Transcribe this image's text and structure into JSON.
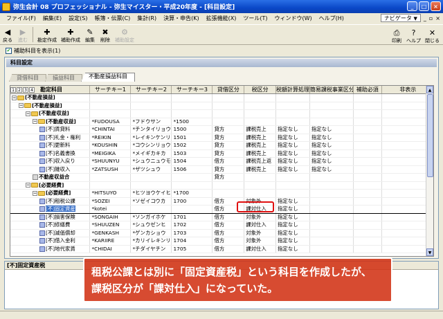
{
  "window": {
    "title": "弥生会計 08 プロフェッショナル - 弥生マイスター・平成20年度 - [科目設定]"
  },
  "menu": [
    "ファイル(F)",
    "編集(E)",
    "設定(S)",
    "帳簿・伝票(C)",
    "集計(R)",
    "決算・申告(K)",
    "拡張機能(X)",
    "ツール(T)",
    "ウィンドウ(W)",
    "ヘルプ(H)"
  ],
  "navi": {
    "label": "ナビゲータ"
  },
  "toolbar": {
    "left": [
      {
        "label": "戻る",
        "icon": "back-icon"
      },
      {
        "label": "進む",
        "icon": "forward-icon",
        "disabled": true
      },
      {
        "label": "勘定作成",
        "icon": "account-create-icon"
      },
      {
        "label": "補助作成",
        "icon": "sub-create-icon"
      },
      {
        "label": "編集",
        "icon": "edit-icon"
      },
      {
        "label": "削除",
        "icon": "delete-icon"
      },
      {
        "label": "補助設定",
        "icon": "sub-setting-icon",
        "disabled": true
      }
    ],
    "right": [
      {
        "label": "印刷",
        "icon": "print-icon"
      },
      {
        "label": "ヘルプ",
        "icon": "help-icon"
      },
      {
        "label": "閉じる",
        "icon": "close-icon"
      }
    ]
  },
  "show_sub_accounts": {
    "label": "補助科目を表示(1)",
    "checked": true
  },
  "panel": {
    "title": "科目設定"
  },
  "tabs": [
    "貸借科目",
    "損益科目",
    "不動産損益科目"
  ],
  "grid": {
    "columns": [
      "勘定科目",
      "サーチキー1",
      "サーチキー2",
      "サーチキー3",
      "貸借区分",
      "税区分",
      "税額計算処理",
      "簡易課税事業区分",
      "補助必須",
      "非表示"
    ],
    "rows": [
      {
        "indent": 0,
        "type": "folder",
        "name": "[不動産損益]",
        "bold": true,
        "k1": "",
        "k2": "",
        "k3": "",
        "tk": "",
        "tax": "",
        "calc": "",
        "simple": ""
      },
      {
        "indent": 1,
        "type": "folder",
        "name": "[不動産損益]",
        "bold": true,
        "k1": "",
        "k2": "",
        "k3": "",
        "tk": "",
        "tax": "",
        "calc": "",
        "simple": ""
      },
      {
        "indent": 2,
        "type": "folder",
        "name": "[不動産収益]",
        "bold": true,
        "k1": "",
        "k2": "",
        "k3": "",
        "tk": "",
        "tax": "",
        "calc": "",
        "simple": ""
      },
      {
        "indent": 3,
        "type": "folder",
        "name": "[不動産収益]",
        "bold": true,
        "k1": "*FUDOUSA",
        "k2": "*フドウサン",
        "k3": "*1500",
        "tk": "",
        "tax": "",
        "calc": "",
        "simple": ""
      },
      {
        "indent": 4,
        "type": "doc",
        "name": "[不]賃貸料",
        "k1": "*CHINTAI",
        "k2": "*チンタイリョウ",
        "k3": "1500",
        "tk": "貸方",
        "tax": "課税売上",
        "calc": "指定なし",
        "simple": "指定なし"
      },
      {
        "indent": 4,
        "type": "doc",
        "name": "[不]礼金・権利",
        "k1": "*REIKIN",
        "k2": "*レイキンケンリ",
        "k3": "1501",
        "tk": "貸方",
        "tax": "課税売上",
        "calc": "指定なし",
        "simple": "指定なし"
      },
      {
        "indent": 4,
        "type": "doc",
        "name": "[不]更新料",
        "k1": "*KOUSHIN",
        "k2": "*コウシンリョウ",
        "k3": "1502",
        "tk": "貸方",
        "tax": "課税売上",
        "calc": "指定なし",
        "simple": "指定なし"
      },
      {
        "indent": 4,
        "type": "doc",
        "name": "[不]名義書換",
        "k1": "*MEIGIKA",
        "k2": "*メイギカキカ",
        "k3": "1503",
        "tk": "貸方",
        "tax": "課税売上",
        "calc": "指定なし",
        "simple": "指定なし"
      },
      {
        "indent": 4,
        "type": "doc",
        "name": "[不]収入戻り",
        "k1": "*SHUUNYU",
        "k2": "*シュウニュウモ",
        "k3": "1504",
        "tk": "借方",
        "tax": "課税売上返",
        "calc": "指定なし",
        "simple": "指定なし"
      },
      {
        "indent": 4,
        "type": "doc",
        "name": "[不]雑収入",
        "k1": "*ZATSUSH",
        "k2": "*ザツシュウ",
        "k3": "1506",
        "tk": "貸方",
        "tax": "課税売上",
        "calc": "指定なし",
        "simple": "指定なし"
      },
      {
        "indent": 3,
        "type": "sum",
        "name": "不動産収益合",
        "bold": true,
        "k1": "",
        "k2": "",
        "k3": "",
        "tk": "貸方",
        "tax": "",
        "calc": "",
        "simple": ""
      },
      {
        "indent": 2,
        "type": "folder",
        "name": "[必要経費]",
        "bold": true,
        "k1": "",
        "k2": "",
        "k3": "",
        "tk": "",
        "tax": "",
        "calc": "",
        "simple": ""
      },
      {
        "indent": 3,
        "type": "folder",
        "name": "[必要経費]",
        "bold": true,
        "k1": "*HITSUYO",
        "k2": "*ヒツヨウケイヒ",
        "k3": "*1700",
        "tk": "",
        "tax": "",
        "calc": "",
        "simple": ""
      },
      {
        "indent": 4,
        "type": "doc",
        "name": "[不]租税公課",
        "k1": "*SOZEI",
        "k2": "*ソゼイコウカ",
        "k3": "1700",
        "tk": "借方",
        "tax": "対象外",
        "calc": "指定なし",
        "simple": ""
      },
      {
        "indent": 4,
        "type": "doc",
        "name": "[不]固定資産",
        "k1": "*kotei",
        "k2": "",
        "k3": "",
        "tk": "借方",
        "tax": "課対仕入",
        "calc": "指定なし",
        "simple": "",
        "selected": true
      },
      {
        "indent": 4,
        "type": "doc",
        "name": "[不]損害保険",
        "k1": "*SONGAIH",
        "k2": "*ソンガイホケ",
        "k3": "1701",
        "tk": "借方",
        "tax": "対象外",
        "calc": "指定なし",
        "simple": ""
      },
      {
        "indent": 4,
        "type": "doc",
        "name": "[不]修繕費",
        "k1": "*SHUUZEN",
        "k2": "*シュウゼンヒ",
        "k3": "1702",
        "tk": "借方",
        "tax": "課対仕入",
        "calc": "指定なし",
        "simple": ""
      },
      {
        "indent": 4,
        "type": "doc",
        "name": "[不]減価償却",
        "k1": "*GENKASH",
        "k2": "*ゲンカショウ",
        "k3": "1703",
        "tk": "借方",
        "tax": "対象外",
        "calc": "指定なし",
        "simple": ""
      },
      {
        "indent": 4,
        "type": "doc",
        "name": "[不]借入金利",
        "k1": "*KARIIRE",
        "k2": "*カリイレキンリ",
        "k3": "1704",
        "tk": "借方",
        "tax": "対象外",
        "calc": "指定なし",
        "simple": ""
      },
      {
        "indent": 4,
        "type": "doc",
        "name": "[不]地代家賃",
        "k1": "*CHIDAI",
        "k2": "*チダイヤチン",
        "k3": "1705",
        "tk": "借方",
        "tax": "課対仕入",
        "calc": "指定なし",
        "simple": ""
      }
    ]
  },
  "lower_panel": {
    "title": "[不]固定資産税"
  },
  "callout": {
    "line1": "租税公課とは別に「固定資産税」という科目を作成したが、",
    "line2": "課税区分が「課対仕入」になっていた。"
  }
}
